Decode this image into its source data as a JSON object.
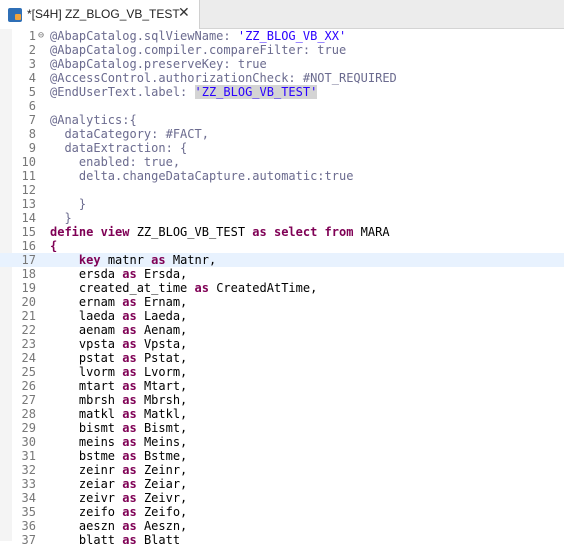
{
  "tab": {
    "title": "*[S4H] ZZ_BLOG_VB_TEST",
    "close": "✕"
  },
  "lines": [
    {
      "n": "1",
      "fold": "⊖",
      "tokens": [
        [
          "ann",
          "@AbapCatalog.sqlViewName: "
        ],
        [
          "str",
          "'ZZ_BLOG_VB_XX'"
        ]
      ]
    },
    {
      "n": "2",
      "tokens": [
        [
          "ann",
          "@AbapCatalog.compiler.compareFilter: true"
        ]
      ]
    },
    {
      "n": "3",
      "tokens": [
        [
          "ann",
          "@AbapCatalog.preserveKey: true"
        ]
      ]
    },
    {
      "n": "4",
      "tokens": [
        [
          "ann",
          "@AccessControl.authorizationCheck: #NOT_REQUIRED"
        ]
      ]
    },
    {
      "n": "5",
      "tokens": [
        [
          "ann",
          "@EndUserText.label: "
        ],
        [
          "hl",
          "'ZZ_BLOG_VB_TEST'"
        ]
      ]
    },
    {
      "n": "6",
      "tokens": []
    },
    {
      "n": "7",
      "tokens": [
        [
          "ann",
          "@Analytics:{"
        ]
      ]
    },
    {
      "n": "8",
      "tokens": [
        [
          "ann",
          "  dataCategory: #FACT,"
        ]
      ]
    },
    {
      "n": "9",
      "tokens": [
        [
          "ann",
          "  dataExtraction: {"
        ]
      ]
    },
    {
      "n": "10",
      "tokens": [
        [
          "ann",
          "    enabled: true,"
        ]
      ]
    },
    {
      "n": "11",
      "tokens": [
        [
          "ann",
          "    delta.changeDataCapture.automatic:true"
        ]
      ]
    },
    {
      "n": "12",
      "tokens": []
    },
    {
      "n": "13",
      "tokens": [
        [
          "ann",
          "    }"
        ]
      ]
    },
    {
      "n": "14",
      "tokens": [
        [
          "ann",
          "  }"
        ]
      ]
    },
    {
      "n": "15",
      "tokens": [
        [
          "kw",
          "define view "
        ],
        [
          "plain",
          "ZZ_BLOG_VB_TEST "
        ],
        [
          "kw",
          "as select from "
        ],
        [
          "plain",
          "MARA"
        ]
      ]
    },
    {
      "n": "16",
      "tokens": [
        [
          "kw",
          "{"
        ]
      ]
    },
    {
      "n": "17",
      "current": true,
      "tokens": [
        [
          "plain",
          "    "
        ],
        [
          "kw",
          "key "
        ],
        [
          "plain",
          "matnr "
        ],
        [
          "kw",
          "as "
        ],
        [
          "plain",
          "Matnr,"
        ]
      ]
    },
    {
      "n": "18",
      "tokens": [
        [
          "plain",
          "    ersda "
        ],
        [
          "kw",
          "as "
        ],
        [
          "plain",
          "Ersda,"
        ]
      ]
    },
    {
      "n": "19",
      "tokens": [
        [
          "plain",
          "    created_at_time "
        ],
        [
          "kw",
          "as "
        ],
        [
          "plain",
          "CreatedAtTime,"
        ]
      ]
    },
    {
      "n": "20",
      "tokens": [
        [
          "plain",
          "    ernam "
        ],
        [
          "kw",
          "as "
        ],
        [
          "plain",
          "Ernam,"
        ]
      ]
    },
    {
      "n": "21",
      "tokens": [
        [
          "plain",
          "    laeda "
        ],
        [
          "kw",
          "as "
        ],
        [
          "plain",
          "Laeda,"
        ]
      ]
    },
    {
      "n": "22",
      "tokens": [
        [
          "plain",
          "    aenam "
        ],
        [
          "kw",
          "as "
        ],
        [
          "plain",
          "Aenam,"
        ]
      ]
    },
    {
      "n": "23",
      "tokens": [
        [
          "plain",
          "    vpsta "
        ],
        [
          "kw",
          "as "
        ],
        [
          "plain",
          "Vpsta,"
        ]
      ]
    },
    {
      "n": "24",
      "tokens": [
        [
          "plain",
          "    pstat "
        ],
        [
          "kw",
          "as "
        ],
        [
          "plain",
          "Pstat,"
        ]
      ]
    },
    {
      "n": "25",
      "tokens": [
        [
          "plain",
          "    lvorm "
        ],
        [
          "kw",
          "as "
        ],
        [
          "plain",
          "Lvorm,"
        ]
      ]
    },
    {
      "n": "26",
      "tokens": [
        [
          "plain",
          "    mtart "
        ],
        [
          "kw",
          "as "
        ],
        [
          "plain",
          "Mtart,"
        ]
      ]
    },
    {
      "n": "27",
      "tokens": [
        [
          "plain",
          "    mbrsh "
        ],
        [
          "kw",
          "as "
        ],
        [
          "plain",
          "Mbrsh,"
        ]
      ]
    },
    {
      "n": "28",
      "tokens": [
        [
          "plain",
          "    matkl "
        ],
        [
          "kw",
          "as "
        ],
        [
          "plain",
          "Matkl,"
        ]
      ]
    },
    {
      "n": "29",
      "tokens": [
        [
          "plain",
          "    bismt "
        ],
        [
          "kw",
          "as "
        ],
        [
          "plain",
          "Bismt,"
        ]
      ]
    },
    {
      "n": "30",
      "tokens": [
        [
          "plain",
          "    meins "
        ],
        [
          "kw",
          "as "
        ],
        [
          "plain",
          "Meins,"
        ]
      ]
    },
    {
      "n": "31",
      "tokens": [
        [
          "plain",
          "    bstme "
        ],
        [
          "kw",
          "as "
        ],
        [
          "plain",
          "Bstme,"
        ]
      ]
    },
    {
      "n": "32",
      "tokens": [
        [
          "plain",
          "    zeinr "
        ],
        [
          "kw",
          "as "
        ],
        [
          "plain",
          "Zeinr,"
        ]
      ]
    },
    {
      "n": "33",
      "tokens": [
        [
          "plain",
          "    zeiar "
        ],
        [
          "kw",
          "as "
        ],
        [
          "plain",
          "Zeiar,"
        ]
      ]
    },
    {
      "n": "34",
      "tokens": [
        [
          "plain",
          "    zeivr "
        ],
        [
          "kw",
          "as "
        ],
        [
          "plain",
          "Zeivr,"
        ]
      ]
    },
    {
      "n": "35",
      "tokens": [
        [
          "plain",
          "    zeifo "
        ],
        [
          "kw",
          "as "
        ],
        [
          "plain",
          "Zeifo,"
        ]
      ]
    },
    {
      "n": "36",
      "tokens": [
        [
          "plain",
          "    aeszn "
        ],
        [
          "kw",
          "as "
        ],
        [
          "plain",
          "Aeszn,"
        ]
      ]
    },
    {
      "n": "37",
      "tokens": [
        [
          "plain",
          "    blatt "
        ],
        [
          "kw",
          "as "
        ],
        [
          "plain",
          "Blatt"
        ]
      ]
    }
  ]
}
